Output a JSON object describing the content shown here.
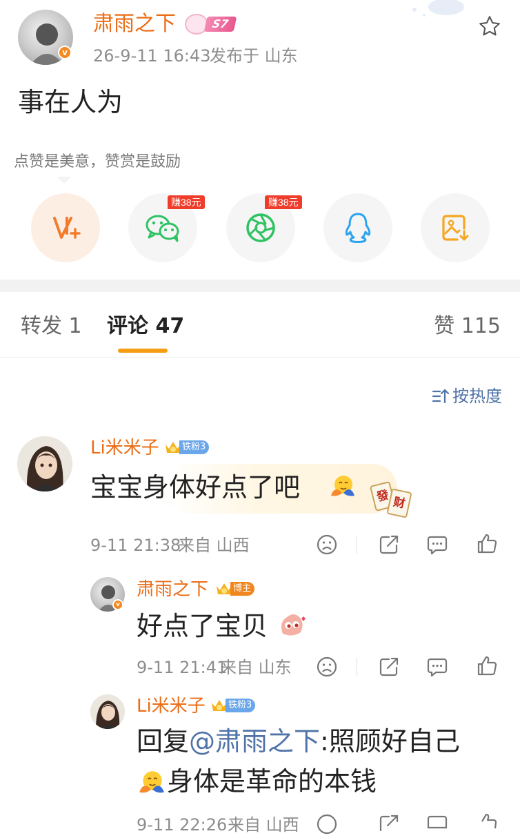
{
  "post": {
    "author": "肃雨之下",
    "level_badge": "S7",
    "time": "26-9-11 16:43",
    "location": "发布于 山东",
    "content": "事在人为",
    "reward_hint": "点赞是美意，赞赏是鼓励"
  },
  "share": {
    "earn_wechat": "赚38元",
    "earn_moments": "赚38元",
    "icons": [
      "reward-v-plus-icon",
      "wechat-icon",
      "moments-icon",
      "qq-icon",
      "save-image-icon"
    ]
  },
  "tabs": {
    "repost": "转发 1",
    "comments": "评论 47",
    "likes": "赞 115"
  },
  "sort": {
    "label": "按热度"
  },
  "comments": [
    {
      "user": "Li米米子",
      "badge": "铁粉3",
      "text": "宝宝身体好点了吧",
      "time": "9-11 21:38",
      "location": "来自 山西",
      "sticker": [
        "發",
        "财"
      ]
    }
  ],
  "replies": [
    {
      "user": "肃雨之下",
      "badge": "博主",
      "text": "好点了宝贝",
      "time": "9-11 21:41",
      "location": "来自 山东"
    },
    {
      "user": "Li米米子",
      "badge": "铁粉3",
      "text_prefix": "回复",
      "mention": "@肃雨之下",
      "text_line1": ":照顾好自己",
      "text_line2": "身体是革命的本钱",
      "time": "9-11 22:26",
      "location": "来自 山西"
    }
  ],
  "colors": {
    "accent_orange": "#eb6d17",
    "tab_indicator": "#f59d12",
    "link_blue": "#5073a8",
    "earn_red": "#f03c2a",
    "wechat_green": "#2fc262",
    "qq_blue": "#2aa3f0"
  }
}
